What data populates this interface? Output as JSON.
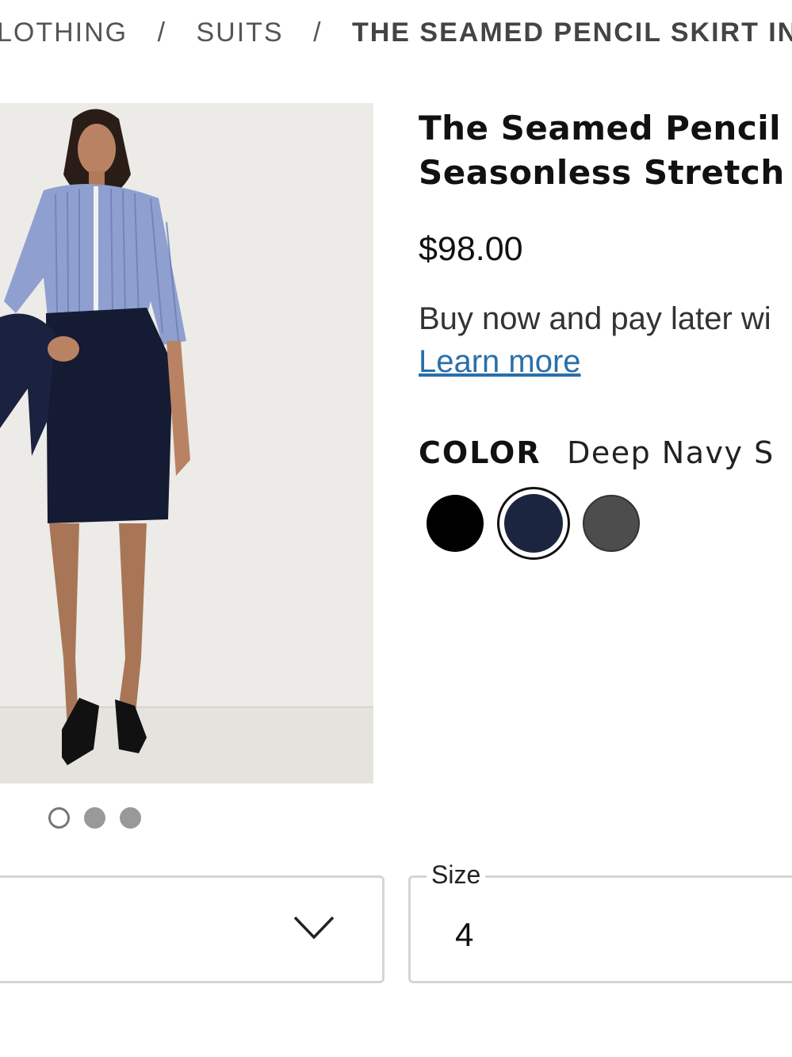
{
  "breadcrumb": {
    "items": [
      "LOTHING",
      "SUITS"
    ],
    "current": "THE SEAMED PENCIL SKIRT IN",
    "separator": "/"
  },
  "product": {
    "title_line1": "The Seamed Pencil S",
    "title_line2": "Seasonless Stretch",
    "price": "$98.00",
    "bnpl_text": "Buy now and pay later wi",
    "learn_more": "Learn more"
  },
  "color": {
    "label": "COLOR",
    "value": "Deep Navy S",
    "swatches": [
      {
        "name": "black",
        "hex": "#000000"
      },
      {
        "name": "deep-navy",
        "hex": "#1c2540",
        "selected": true
      },
      {
        "name": "grey",
        "hex": "#4d4d4d"
      }
    ]
  },
  "carousel": {
    "count": 3,
    "active_index": 0
  },
  "size": {
    "legend": "Size",
    "value": "4"
  },
  "colors": {
    "link": "#2a6fa8",
    "image_bg": "#ebeae6"
  }
}
